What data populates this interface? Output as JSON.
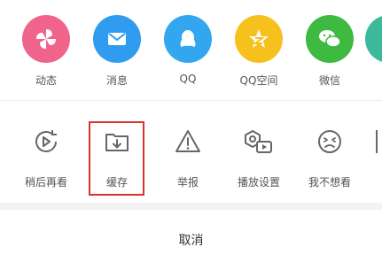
{
  "share_row": [
    {
      "label": "动态",
      "icon": "pinwheel-icon",
      "color": "#f0648c"
    },
    {
      "label": "消息",
      "icon": "envelope-icon",
      "color": "#2f9cf0"
    },
    {
      "label": "QQ",
      "icon": "qq-penguin-icon",
      "color": "#32a7f0"
    },
    {
      "label": "QQ空间",
      "icon": "qzone-star-icon",
      "color": "#f6c11d"
    },
    {
      "label": "微信",
      "icon": "wechat-icon",
      "color": "#3dba3f"
    }
  ],
  "action_row": [
    {
      "label": "稍后再看",
      "icon": "watch-later-icon"
    },
    {
      "label": "缓存",
      "icon": "download-folder-icon",
      "highlighted": true
    },
    {
      "label": "举报",
      "icon": "warning-triangle-icon"
    },
    {
      "label": "播放设置",
      "icon": "play-settings-icon"
    },
    {
      "label": "我不想看",
      "icon": "dislike-face-icon"
    }
  ],
  "cancel_label": "取消",
  "highlight_color": "#d9342b"
}
